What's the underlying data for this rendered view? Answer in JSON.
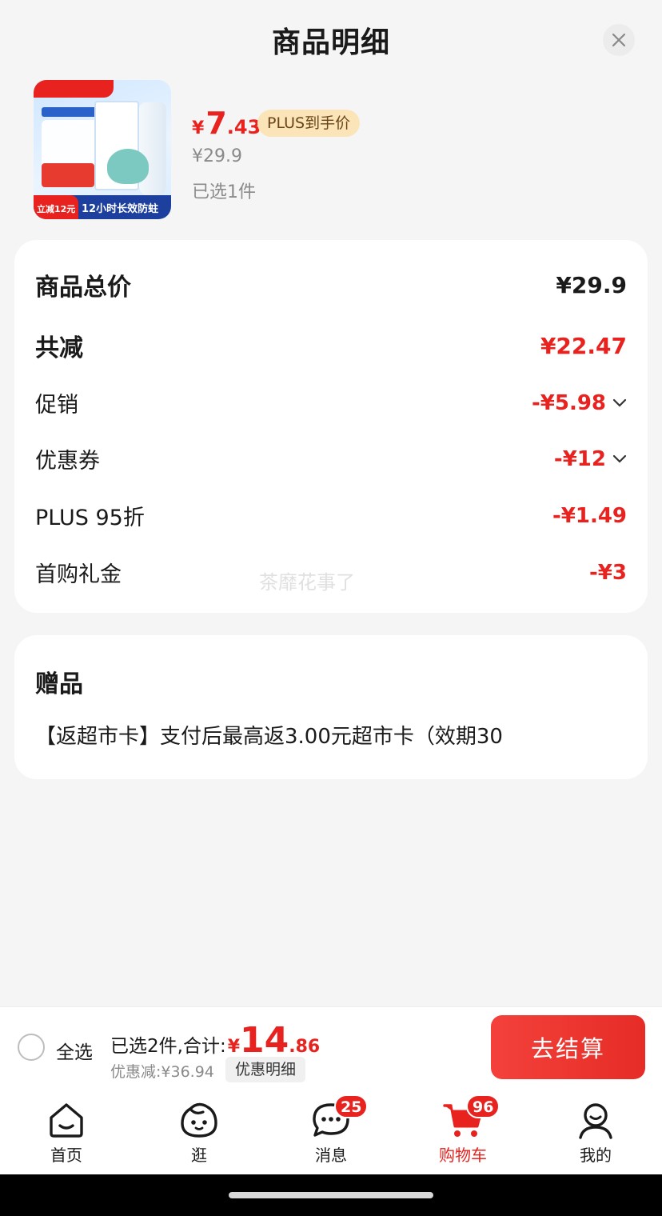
{
  "header": {
    "title": "商品明细"
  },
  "product": {
    "price_yen": "¥",
    "price_int": "7",
    "price_dec": ".43",
    "plus_badge": "PLUS到手价",
    "original_price": "¥29.9",
    "selected": "已选1件",
    "thumb_banner": "12小时长效防蛀",
    "thumb_left": "立减12元"
  },
  "price_detail": {
    "total_label": "商品总价",
    "total_value": "¥29.9",
    "reduce_label": "共减",
    "reduce_value": "¥22.47",
    "items": [
      {
        "label": "促销",
        "value": "-¥5.98",
        "expandable": true
      },
      {
        "label": "优惠券",
        "value": "-¥12",
        "expandable": true
      },
      {
        "label": "PLUS 95折",
        "value": "-¥1.49",
        "expandable": false
      },
      {
        "label": "首购礼金",
        "value": "-¥3",
        "expandable": false
      }
    ],
    "watermark": "茶靡花事了"
  },
  "gift": {
    "title": "赠品",
    "text": "【返超市卡】支付后最高返3.00元超市卡（效期30"
  },
  "checkout": {
    "select_all": "全选",
    "summary": "已选2件,合计:",
    "total_yen": "¥",
    "total_int": "14",
    "total_dec": ".86",
    "discount": "优惠减:¥36.94",
    "discount_detail": "优惠明细",
    "button": "去结算"
  },
  "tabs": [
    {
      "label": "首页",
      "icon": "home-icon"
    },
    {
      "label": "逛",
      "icon": "browse-icon"
    },
    {
      "label": "消息",
      "icon": "message-icon",
      "badge": "25"
    },
    {
      "label": "购物车",
      "icon": "cart-icon",
      "badge": "96",
      "active": true
    },
    {
      "label": "我的",
      "icon": "profile-icon"
    }
  ],
  "colors": {
    "accent": "#e8231f",
    "plus_badge_bg": "#fbe5b8",
    "background": "#f5f5f5"
  }
}
